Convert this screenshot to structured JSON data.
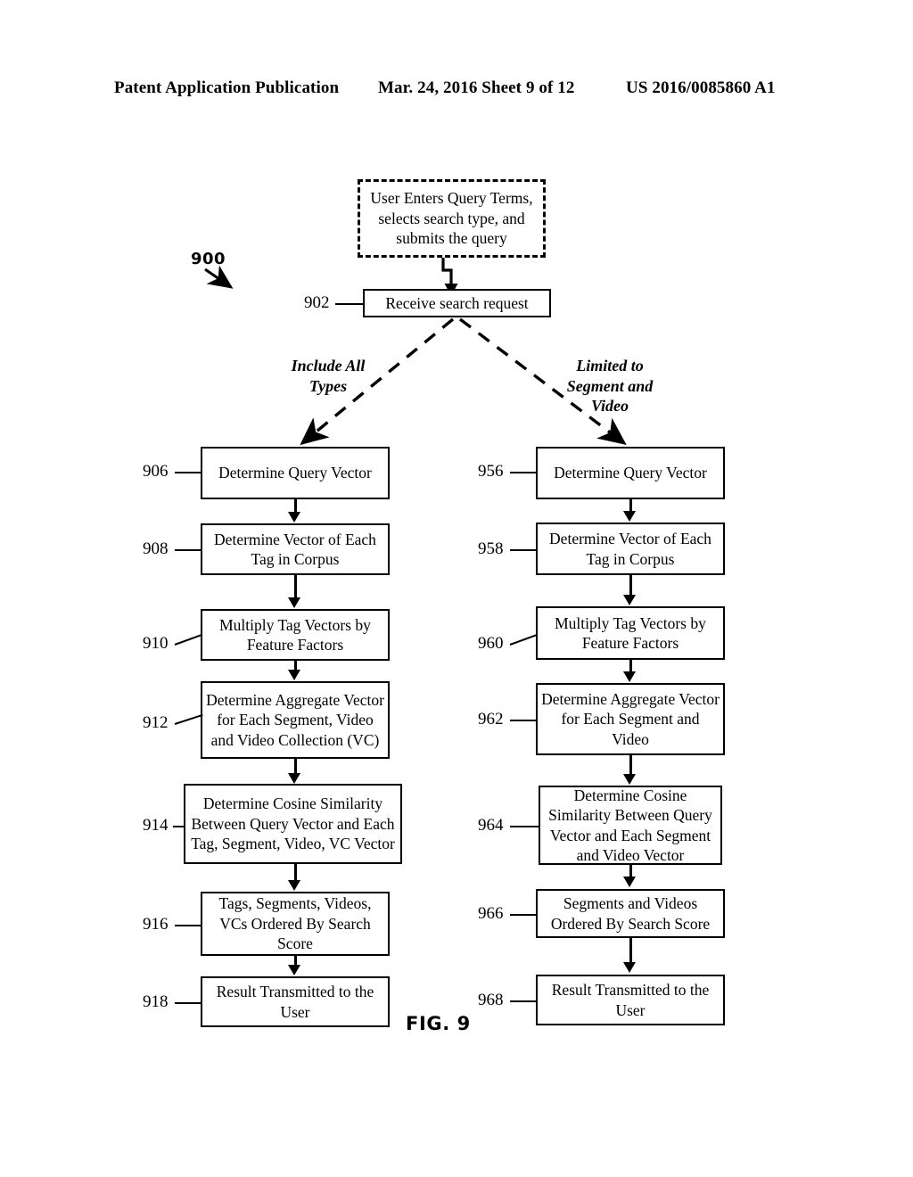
{
  "header": {
    "left": "Patent Application Publication",
    "middle": "Mar. 24, 2016  Sheet 9 of 12",
    "right": "US 2016/0085860 A1"
  },
  "figure": {
    "label": "FIG. 9",
    "diagram_number": "900"
  },
  "start": {
    "ref": "",
    "text": "User Enters Query Terms, selects search type, and submits the query"
  },
  "receive": {
    "ref": "902",
    "text": "Receive search request"
  },
  "branches": {
    "left_label": "Include All\nTypes",
    "right_label": "Limited to\nSegment and\nVideo"
  },
  "left_column": [
    {
      "ref": "906",
      "text": "Determine Query Vector"
    },
    {
      "ref": "908",
      "text": "Determine Vector of Each Tag in Corpus"
    },
    {
      "ref": "910",
      "text": "Multiply Tag Vectors by Feature Factors"
    },
    {
      "ref": "912",
      "text": "Determine Aggregate Vector for Each Segment, Video and Video Collection (VC)"
    },
    {
      "ref": "914",
      "text": "Determine Cosine Similarity Between Query Vector and Each Tag, Segment, Video, VC Vector"
    },
    {
      "ref": "916",
      "text": "Tags, Segments, Videos, VCs Ordered By Search Score"
    },
    {
      "ref": "918",
      "text": "Result Transmitted to the User"
    }
  ],
  "right_column": [
    {
      "ref": "956",
      "text": "Determine Query Vector"
    },
    {
      "ref": "958",
      "text": "Determine Vector of Each Tag in Corpus"
    },
    {
      "ref": "960",
      "text": "Multiply Tag Vectors by Feature Factors"
    },
    {
      "ref": "962",
      "text": "Determine Aggregate Vector for Each Segment and Video"
    },
    {
      "ref": "964",
      "text": "Determine Cosine Similarity Between Query Vector and Each Segment and Video Vector"
    },
    {
      "ref": "966",
      "text": "Segments and Videos Ordered By Search Score"
    },
    {
      "ref": "968",
      "text": "Result Transmitted to the User"
    }
  ],
  "colors": {
    "ink": "#000000",
    "paper": "#ffffff"
  }
}
